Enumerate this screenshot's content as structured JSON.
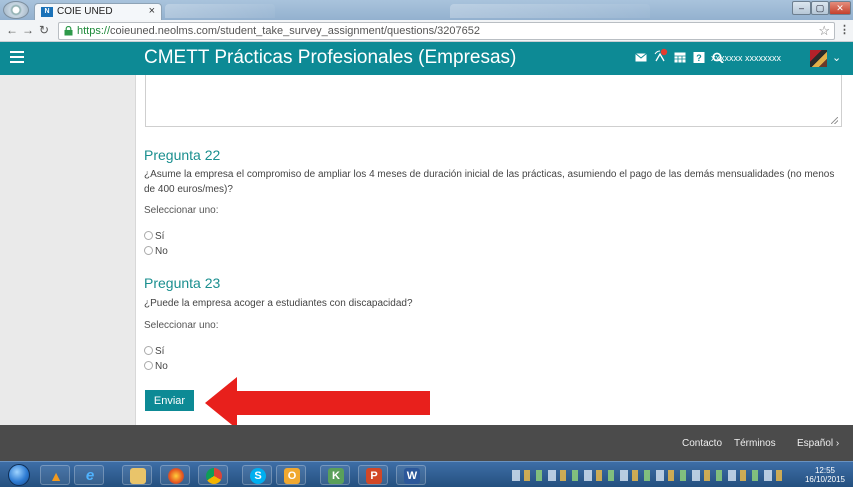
{
  "browser": {
    "tab_title": "COIE UNED",
    "tab_favicon_text": "N",
    "url_scheme": "https://",
    "url_rest": "coieuned.neolms.com/student_take_survey_assignment/questions/3207652"
  },
  "header": {
    "title": "CMETT Prácticas Profesionales (Empresas)",
    "user_name": "xxxxxxx xxxxxxxx"
  },
  "questions": [
    {
      "title": "Pregunta 22",
      "text": "¿Asume la empresa el compromiso de ampliar los 4 meses de duración inicial de las prácticas, asumiendo el pago de las demás mensualidades (no menos de 400 euros/mes)?",
      "instruction": "Seleccionar uno:",
      "options": [
        "Sí",
        "No"
      ]
    },
    {
      "title": "Pregunta 23",
      "text": "¿Puede la empresa acoger a estudiantes con discapacidad?",
      "instruction": "Seleccionar uno:",
      "options": [
        "Sí",
        "No"
      ]
    }
  ],
  "submit_label": "Enviar",
  "footer": {
    "contact": "Contacto",
    "terms": "Términos",
    "language": "Español ›"
  },
  "taskbar": {
    "time": "12:55",
    "date": "16/10/2015"
  },
  "colors": {
    "accent": "#0d8a95",
    "question_title": "#1a8f8f",
    "annotation_arrow": "#e8201c"
  }
}
